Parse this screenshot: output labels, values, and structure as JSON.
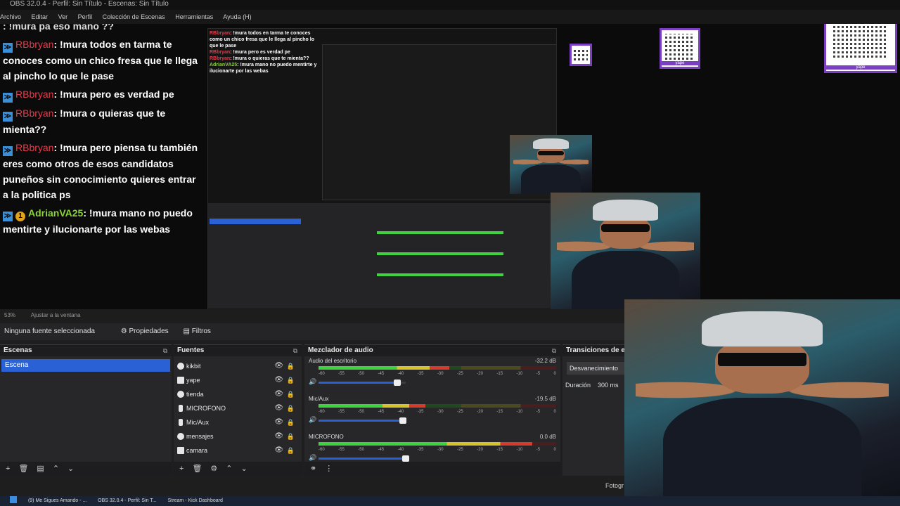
{
  "window": {
    "title": "OBS 32.0.4 - Perfil: Sin Título - Escenas: Sin Título",
    "menu": [
      "Archivo",
      "Editar",
      "Ver",
      "Perfil",
      "Colección de Escenas",
      "Herramientas",
      "Ayuda (H)"
    ]
  },
  "chat": {
    "messages": [
      {
        "user": "RBbryan",
        "text": ": !mura todos en tarma te conoces como un chico fresa que le llega al pincho lo que le pase"
      },
      {
        "user": "RBbryan",
        "text": ": !mura pero es verdad pe"
      },
      {
        "user": "RBbryan",
        "text": ": !mura o quieras que te mienta??"
      },
      {
        "user": "RBbryan",
        "text": ": !mura pero piensa tu también eres como otros de esos candidatos puneños sin conocimiento quieres entrar a la politica ps"
      },
      {
        "user": "AdrianVA25",
        "text": ": !mura mano no puedo mentirte y ilucionarte por las webas",
        "badge": "1"
      }
    ],
    "header_fragment": ": !mura pa eso mano ??"
  },
  "qr": {
    "label": "yape"
  },
  "status": {
    "zoom": "53%",
    "fit": "Ajustar a la ventana"
  },
  "context": {
    "no_source": "Ninguna fuente seleccionada",
    "properties": "Propiedades",
    "filters": "Filtros"
  },
  "docks": {
    "scenes": {
      "title": "Escenas",
      "items": [
        "Escena"
      ]
    },
    "sources": {
      "title": "Fuentes",
      "items": [
        {
          "name": "kikbit",
          "kind": "browser"
        },
        {
          "name": "yape",
          "kind": "image"
        },
        {
          "name": "tienda",
          "kind": "browser"
        },
        {
          "name": "MICROFONO",
          "kind": "mic"
        },
        {
          "name": "Mic/Aux",
          "kind": "mic"
        },
        {
          "name": "mensajes",
          "kind": "browser"
        },
        {
          "name": "camara",
          "kind": "camera"
        }
      ]
    },
    "mixer": {
      "title": "Mezclador de audio",
      "ticks": [
        "-60",
        "-55",
        "-50",
        "-45",
        "-40",
        "-35",
        "-30",
        "-25",
        "-20",
        "-15",
        "-10",
        "-5",
        "0"
      ],
      "channels": [
        {
          "name": "Audio del escritorio",
          "db": "-32.2 dB",
          "level": 0.55,
          "volume": 0.9
        },
        {
          "name": "Mic/Aux",
          "db": "-19.5 dB",
          "level": 0.45,
          "volume": 0.97
        },
        {
          "name": "MICROFONO",
          "db": "0.0 dB",
          "level": 0.9,
          "volume": 1.0
        }
      ]
    },
    "transitions": {
      "title": "Transiciones de escena",
      "transition": "Desvanecimiento",
      "duration_label": "Duración",
      "duration_value": "300 ms"
    }
  },
  "controls_fragment": "Fotogr",
  "taskbar": {
    "items": [
      "(9) Me Sigues Amando - ...",
      "OBS 32.0.4 - Perfil: Sin T...",
      "Stream - Kick Dashboard"
    ]
  }
}
